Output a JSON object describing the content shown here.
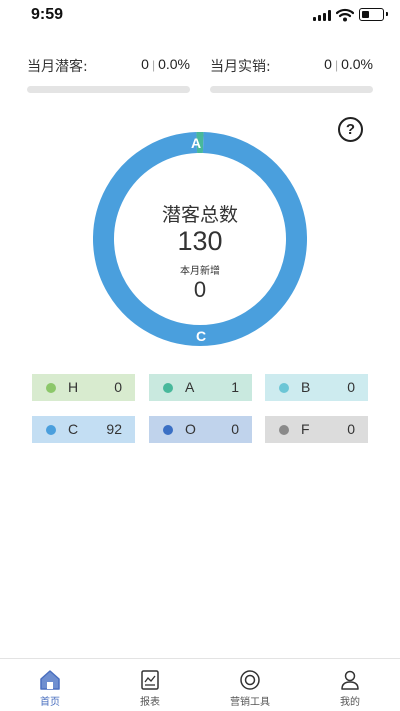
{
  "status_bar": {
    "time": "9:59"
  },
  "stats": [
    {
      "label": "当月潜客:",
      "count": "0",
      "percent": "0.0%",
      "progress": 0
    },
    {
      "label": "当月实销:",
      "count": "0",
      "percent": "0.0%",
      "progress": 0
    }
  ],
  "help": {
    "glyph": "?"
  },
  "donut": {
    "title": "潜客总数",
    "total": "130",
    "subtitle": "本月新增",
    "new_count": "0",
    "segment_labels": {
      "a": "A",
      "c": "C"
    }
  },
  "chart_data": {
    "type": "pie",
    "categories": [
      "H",
      "A",
      "B",
      "C",
      "O",
      "F"
    ],
    "values": [
      0,
      1,
      0,
      92,
      0,
      0
    ],
    "colors": [
      "#8cc76a",
      "#48b89b",
      "#6cc6d6",
      "#4a9fdd",
      "#3a6fc4",
      "#8a8a8a"
    ]
  },
  "legend": [
    {
      "cat": "H",
      "count": "0",
      "dot": "#8cc76a",
      "bg": "#d8ebcf"
    },
    {
      "cat": "A",
      "count": "1",
      "dot": "#48b89b",
      "bg": "#c9e9df"
    },
    {
      "cat": "B",
      "count": "0",
      "dot": "#6cc6d6",
      "bg": "#cdebef"
    },
    {
      "cat": "C",
      "count": "92",
      "dot": "#4a9fdd",
      "bg": "#c3def3"
    },
    {
      "cat": "O",
      "count": "0",
      "dot": "#3a6fc4",
      "bg": "#c0d3ec"
    },
    {
      "cat": "F",
      "count": "0",
      "dot": "#8a8a8a",
      "bg": "#dcdcdc"
    }
  ],
  "tabs": [
    {
      "label": "首页",
      "icon": "home-icon",
      "active": true
    },
    {
      "label": "报表",
      "icon": "report-icon",
      "active": false
    },
    {
      "label": "营销工具",
      "icon": "target-icon",
      "active": false
    },
    {
      "label": "我的",
      "icon": "user-icon",
      "active": false
    }
  ],
  "colors": {
    "accent": "#4a9fdd",
    "tab_active": "#4a6fbf"
  }
}
